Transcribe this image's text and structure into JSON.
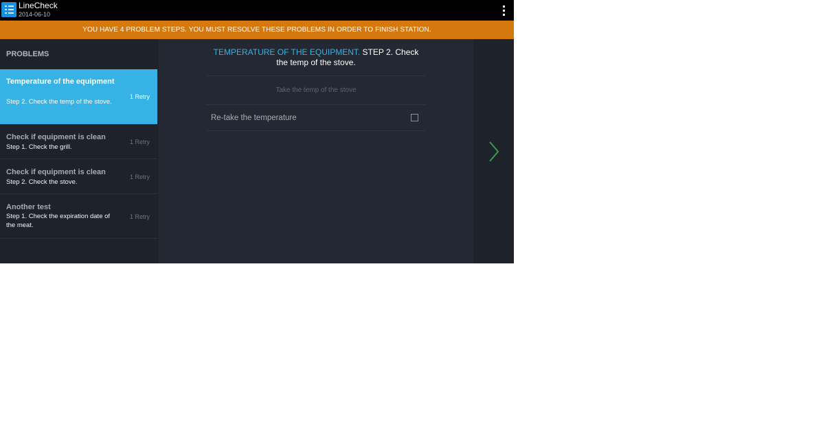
{
  "app": {
    "title": "LineCheck",
    "date": "2014-06-10",
    "icon": "checklist-icon",
    "overflow_icon": "more-vert-icon"
  },
  "banner": {
    "text": "YOU HAVE 4 PROBLEM STEPS. YOU MUST RESOLVE THESE PROBLEMS IN ORDER TO FINISH STATION.",
    "color": "#d5790f"
  },
  "problems": {
    "header": "PROBLEMS",
    "items": [
      {
        "title": "Temperature of the equipment",
        "subtitle": "Step 2. Check the temp of the stove.",
        "retry": "1 Retry",
        "selected": true
      },
      {
        "title": "Check if equipment is clean",
        "subtitle": "Step 1. Check the grill.",
        "retry": "1 Retry",
        "selected": false
      },
      {
        "title": "Check if equipment is clean",
        "subtitle": "Step 2. Check the stove.",
        "retry": "1 Retry",
        "selected": false
      },
      {
        "title": "Another test",
        "subtitle": "Step 1. Check the expiration date of the meat.",
        "retry": "1 Retry",
        "selected": false
      }
    ]
  },
  "detail": {
    "equipment": "TEMPERATURE OF THE EQUIPMENT.",
    "step": "STEP 2. Check the temp of the stove.",
    "instruction": "Take the temp of the stove",
    "task": "Re-take the temperature",
    "task_checked": false
  },
  "navigation": {
    "next_icon": "chevron-right-icon"
  },
  "colors": {
    "accent": "#36b2e4",
    "next_arrow": "#3d9a4a",
    "background": "#1e232b"
  }
}
